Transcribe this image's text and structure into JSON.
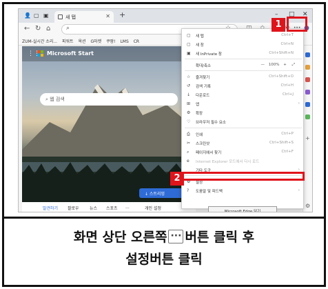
{
  "browser": {
    "tab_title": "새 탭",
    "new_tab_symbol": "+",
    "min_symbol": "–",
    "max_symbol": "□",
    "close_symbol": "✕",
    "menu_button": "···"
  },
  "favorites": [
    "ZUM-실시간 소리...",
    "피워트",
    "옥션",
    "G마켓",
    "쿠팡!",
    "LMS",
    "CR"
  ],
  "content": {
    "brand": "Microsoft Start",
    "search_placeholder": "웹 검색",
    "news_button": "↓ 스트리밍",
    "bottom_tabs": [
      "발견하기",
      "팔로우",
      "뉴스",
      "스포츠",
      "...",
      "개인 설정"
    ]
  },
  "menu": {
    "items": [
      {
        "icon": "▢",
        "label": "새 탭",
        "shortcut": "Ctrl+T"
      },
      {
        "icon": "▢",
        "label": "새 창",
        "shortcut": "Ctrl+N"
      },
      {
        "icon": "▣",
        "label": "새 InPrivate 창",
        "shortcut": "Ctrl+Shift+N"
      },
      {
        "icon": "",
        "label": "확대/축소",
        "shortcut": ""
      },
      {
        "icon": "☆",
        "label": "즐겨찾기",
        "shortcut": "Ctrl+Shift+O"
      },
      {
        "icon": "↺",
        "label": "검색 기록",
        "shortcut": "Ctrl+H"
      },
      {
        "icon": "↓",
        "label": "다운로드",
        "shortcut": "Ctrl+J"
      },
      {
        "icon": "⊞",
        "label": "앱",
        "shortcut": ""
      },
      {
        "icon": "⚙",
        "label": "확장",
        "shortcut": ""
      },
      {
        "icon": "♡",
        "label": "브라우저 필수 요소",
        "shortcut": ""
      },
      {
        "icon": "⎙",
        "label": "인쇄",
        "shortcut": "Ctrl+P"
      },
      {
        "icon": "✂",
        "label": "스크린샷",
        "shortcut": "Ctrl+Shift+S"
      },
      {
        "icon": "⌕",
        "label": "페이지에서 찾기",
        "shortcut": "Ctrl+F"
      },
      {
        "icon": "e",
        "label": "Internet Explorer 모드에서 다시 로드",
        "shortcut": ""
      },
      {
        "icon": "",
        "label": "기타 도구",
        "shortcut": ""
      },
      {
        "icon": "⚙",
        "label": "설정",
        "shortcut": ""
      },
      {
        "icon": "?",
        "label": "도움말 및 피드백",
        "shortcut": ""
      }
    ],
    "zoom_minus": "—",
    "zoom_value": "100%",
    "zoom_plus": "+",
    "zoom_expand": "⤢",
    "about": "Microsoft Edge 닫기"
  },
  "annotations": {
    "step1": "1",
    "step2": "2"
  },
  "caption": {
    "line1_before": "화면 상단 오른쪽",
    "line1_btn": "···",
    "line1_after": "버튼 클릭 후",
    "line2": "설정버튼 클릭"
  },
  "colors": {
    "highlight": "#e0141b",
    "accent": "#2e6bd6"
  }
}
